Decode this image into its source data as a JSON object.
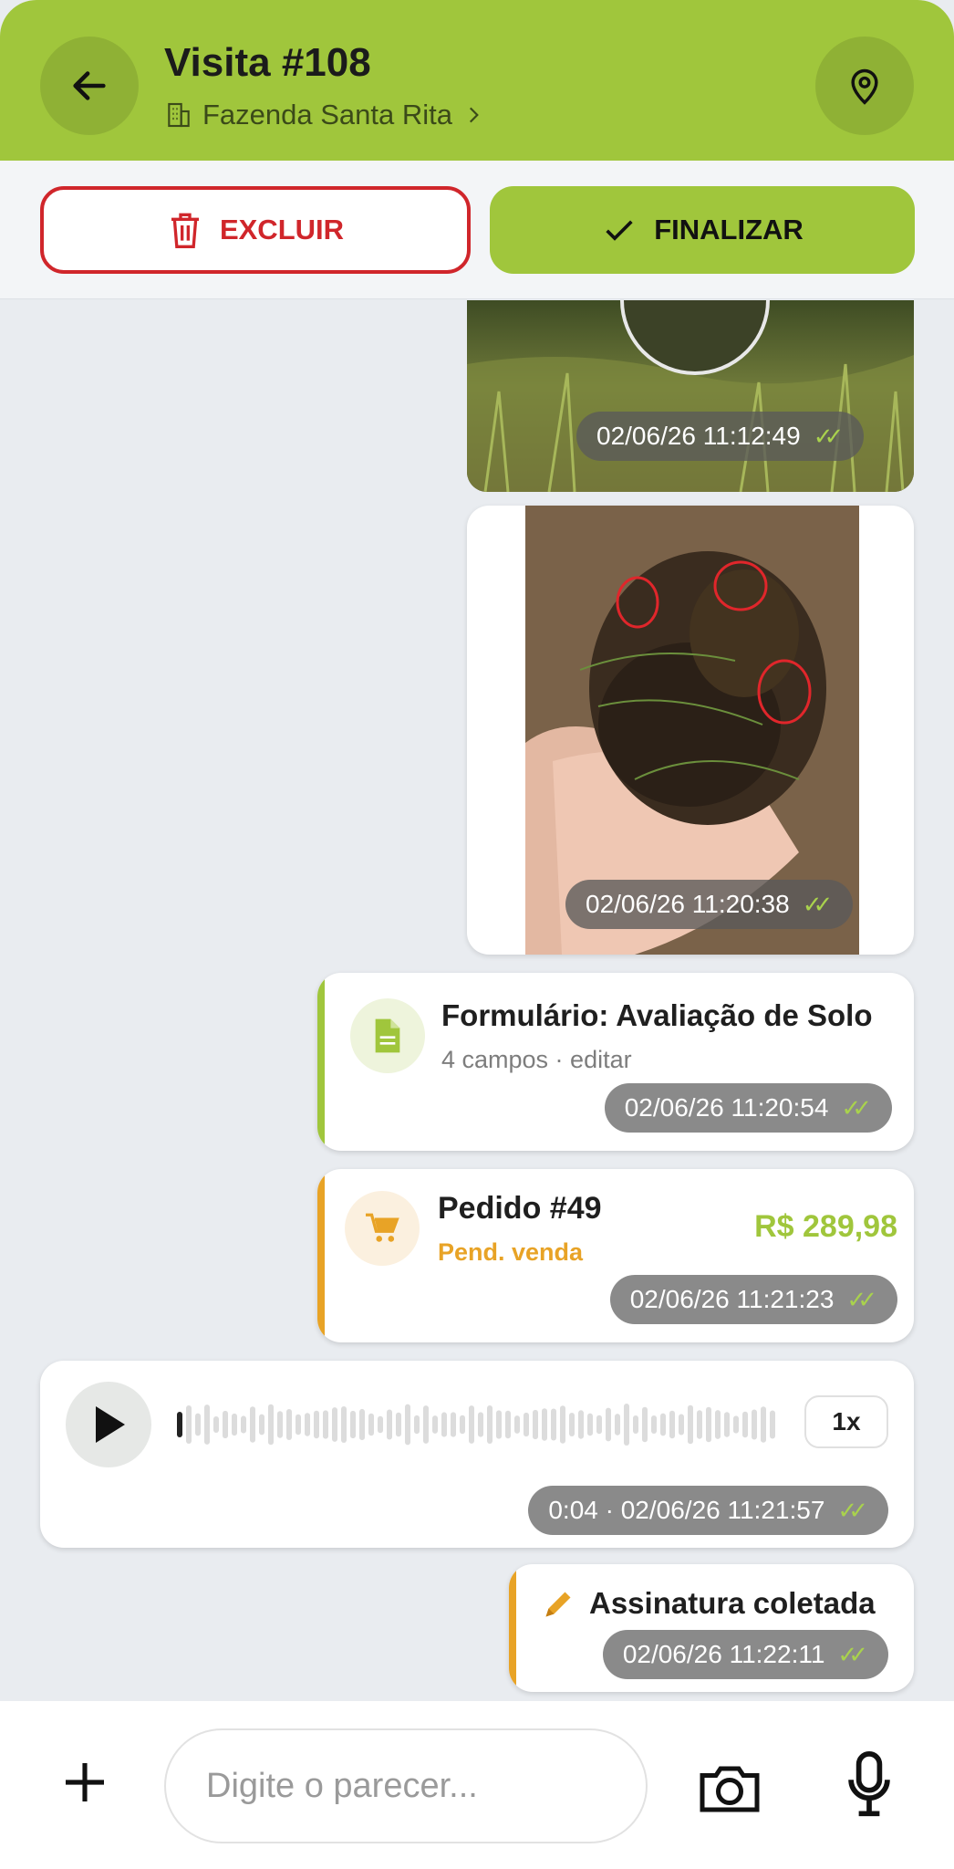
{
  "header": {
    "title": "Visita #108",
    "farm_name": "Fazenda Santa Rita"
  },
  "actions": {
    "delete_label": "EXCLUIR",
    "finish_label": "FINALIZAR"
  },
  "messages": {
    "photo1": {
      "timestamp": "02/06/26 11:12:49"
    },
    "photo2": {
      "timestamp": "02/06/26 11:20:38"
    },
    "form": {
      "title": "Formulário: Avaliação de Solo",
      "subtitle": "4 campos · editar",
      "timestamp": "02/06/26 11:20:54"
    },
    "order": {
      "title": "Pedido #49",
      "status": "Pend. venda",
      "price": "R$ 289,98",
      "timestamp": "02/06/26 11:21:23"
    },
    "audio": {
      "speed": "1x",
      "meta": "0:04 · 02/06/26 11:21:57"
    },
    "signature": {
      "title": "Assinatura coletada",
      "timestamp": "02/06/26 11:22:11"
    }
  },
  "composer": {
    "placeholder": "Digite o parecer..."
  },
  "colors": {
    "brand_green": "#a0c63c",
    "danger_red": "#d0262b",
    "order_orange": "#e8a326"
  },
  "icons": [
    "back-arrow-icon",
    "building-icon",
    "chevron-right-icon",
    "map-pin-icon",
    "trash-icon",
    "check-icon",
    "document-icon",
    "cart-icon",
    "play-icon",
    "pencil-icon",
    "plus-icon",
    "camera-icon",
    "microphone-icon"
  ]
}
